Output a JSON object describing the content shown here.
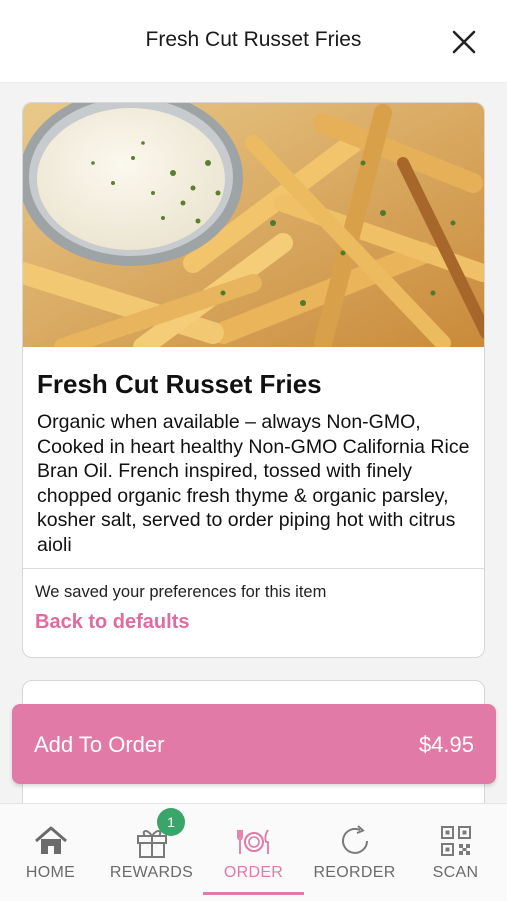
{
  "header": {
    "title": "Fresh Cut Russet Fries",
    "close_icon": "close-icon"
  },
  "item": {
    "title": "Fresh Cut Russet Fries",
    "description": "Organic when available – always Non-GMO, Cooked in heart healthy Non-GMO California Rice Bran Oil. French inspired, tossed with finely chopped organic fresh thyme & organic parsley, kosher salt, served to order piping hot with citrus aioli",
    "preferences_note": "We saved your preferences for this item",
    "defaults_link": "Back to defaults"
  },
  "order_button": {
    "label": "Add To Order",
    "price": "$4.95"
  },
  "tabbar": {
    "items": [
      {
        "label": "HOME",
        "icon": "home-icon"
      },
      {
        "label": "REWARDS",
        "icon": "gift-icon",
        "badge": "1"
      },
      {
        "label": "ORDER",
        "icon": "utensils-icon",
        "active": true
      },
      {
        "label": "REORDER",
        "icon": "refresh-icon"
      },
      {
        "label": "SCAN",
        "icon": "qr-code-icon"
      }
    ]
  },
  "colors": {
    "accent": "#e27aa8",
    "badge": "#3aa56b",
    "link": "#e06aa1"
  }
}
